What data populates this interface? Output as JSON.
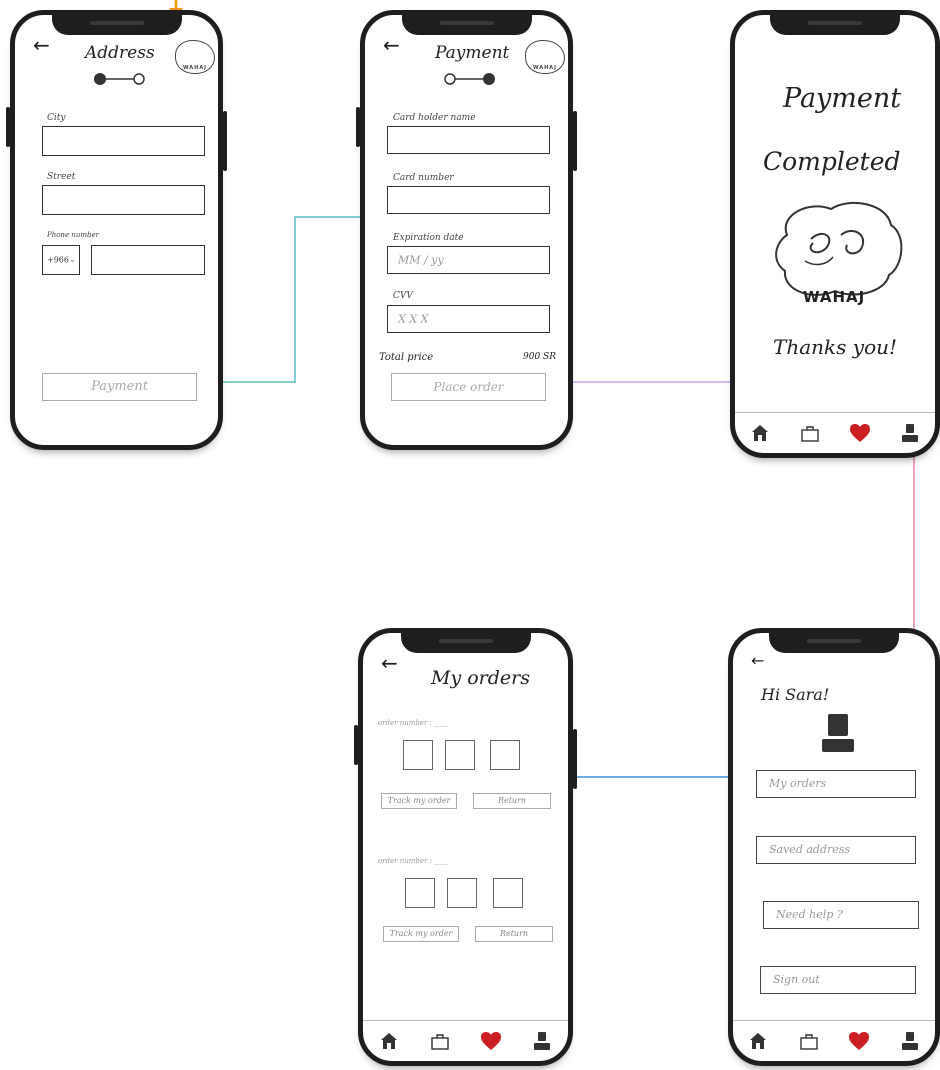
{
  "screens": {
    "address": {
      "title": "Address",
      "labels": {
        "city": "City",
        "street": "Street",
        "phone": "Phone number"
      },
      "country_code": "+966",
      "button": "Payment"
    },
    "payment": {
      "title": "Payment",
      "labels": {
        "card_holder": "Card holder name",
        "card_number": "Card number",
        "expiration": "Expiration date",
        "cvv": "CVV"
      },
      "placeholders": {
        "expiration": "MM / yy",
        "cvv": "X X X"
      },
      "total_label": "Total price",
      "total_value": "900 SR",
      "button": "Place order"
    },
    "completed": {
      "line1": "Payment",
      "line2": "Completed",
      "thanks": "Thanks you!",
      "logo_text": "WAHAJ"
    },
    "profile": {
      "greeting": "Hi Sara!",
      "menu": [
        "My orders",
        "Saved address",
        "Need help ?",
        "Sign out"
      ]
    },
    "orders": {
      "title": "My orders",
      "order_label": "order number : ____",
      "track_label": "Track my order",
      "return_label": "Return"
    }
  },
  "logo_text": "WAHAJ",
  "colors": {
    "arrow_top": "#f0960a",
    "arrow_teal": "#5bbcc0",
    "arrow_purple": "#c9a0e8",
    "arrow_pink": "#e88aa8",
    "arrow_blue": "#3f8fd6",
    "heart": "#cc1f24"
  },
  "icons": [
    "home-icon",
    "bag-icon",
    "heart-icon",
    "user-icon",
    "back-arrow-icon"
  ]
}
